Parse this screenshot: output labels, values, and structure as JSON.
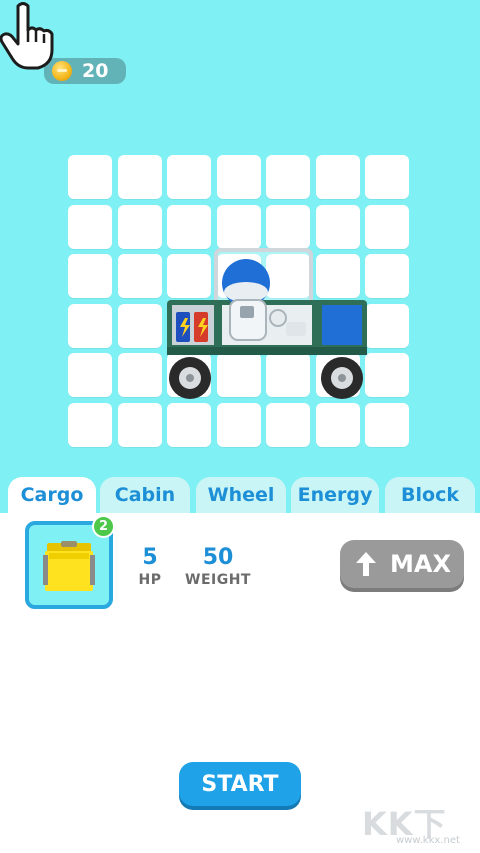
{
  "currency": {
    "icon": "coin-icon",
    "count": "20"
  },
  "grid": {
    "rows": 6,
    "cols": 7
  },
  "tabs": [
    {
      "label": "Cargo",
      "active": true
    },
    {
      "label": "Cabin",
      "active": false
    },
    {
      "label": "Wheel",
      "active": false
    },
    {
      "label": "Energy",
      "active": false
    },
    {
      "label": "Block",
      "active": false
    }
  ],
  "item": {
    "icon": "yellow-crate-icon",
    "badge": "2"
  },
  "stats": {
    "hp_value": "5",
    "hp_label": "HP",
    "weight_value": "50",
    "weight_label": "WEIGHT"
  },
  "upgrade": {
    "icon": "up-arrow-icon",
    "label": "MAX"
  },
  "start": {
    "label": "START"
  },
  "watermark": {
    "big": "KK下载",
    "small": "www.kkx.net"
  },
  "colors": {
    "background": "#7ff0f3",
    "accent": "#1d8fd6",
    "start": "#1fa2e8",
    "max": "#9a9a9a",
    "badge": "#4dc84a"
  }
}
